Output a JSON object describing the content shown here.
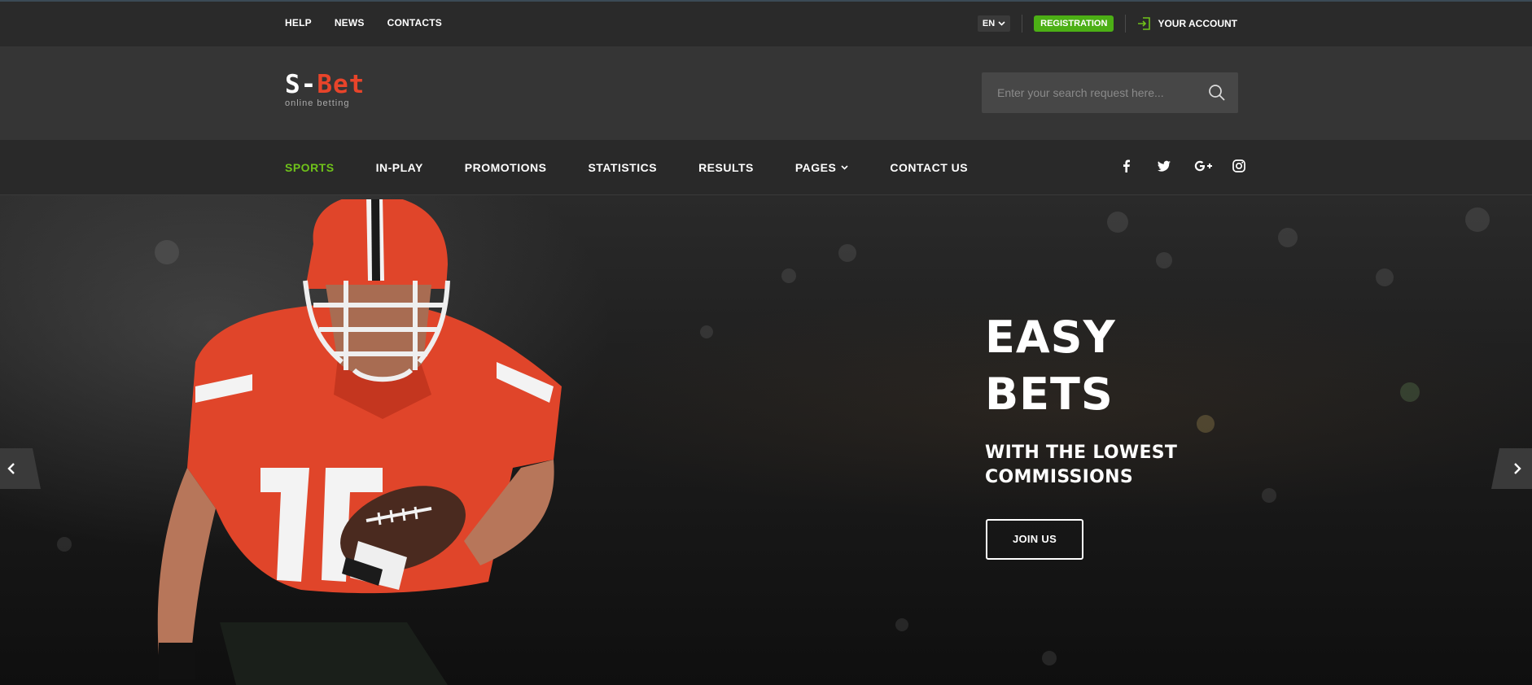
{
  "topbar": {
    "links": [
      "HELP",
      "NEWS",
      "CONTACTS"
    ],
    "language": "EN",
    "registration_label": "REGISTRATION",
    "account_label": "YOUR ACCOUNT"
  },
  "header": {
    "logo_left": "S-",
    "logo_right": "Bet",
    "logo_tagline": "online betting",
    "search_placeholder": "Enter your search request here..."
  },
  "nav": {
    "items": [
      {
        "label": "SPORTS",
        "active": true
      },
      {
        "label": "IN-PLAY"
      },
      {
        "label": "PROMOTIONS"
      },
      {
        "label": "STATISTICS"
      },
      {
        "label": "RESULTS"
      },
      {
        "label": "PAGES",
        "dropdown": true
      },
      {
        "label": "CONTACT US"
      }
    ],
    "social_icons": [
      "facebook-icon",
      "twitter-icon",
      "google-plus-icon",
      "instagram-icon"
    ]
  },
  "hero": {
    "title_line1": "EASY",
    "title_line2": "BETS",
    "subtitle_line1": "WITH THE LOWEST",
    "subtitle_line2": "COMMISSIONS",
    "cta_label": "JOIN US"
  },
  "colors": {
    "accent_green": "#6fc21a",
    "registration_green": "#4caf15",
    "logo_red": "#e8442a",
    "jersey_red": "#e0452a"
  }
}
